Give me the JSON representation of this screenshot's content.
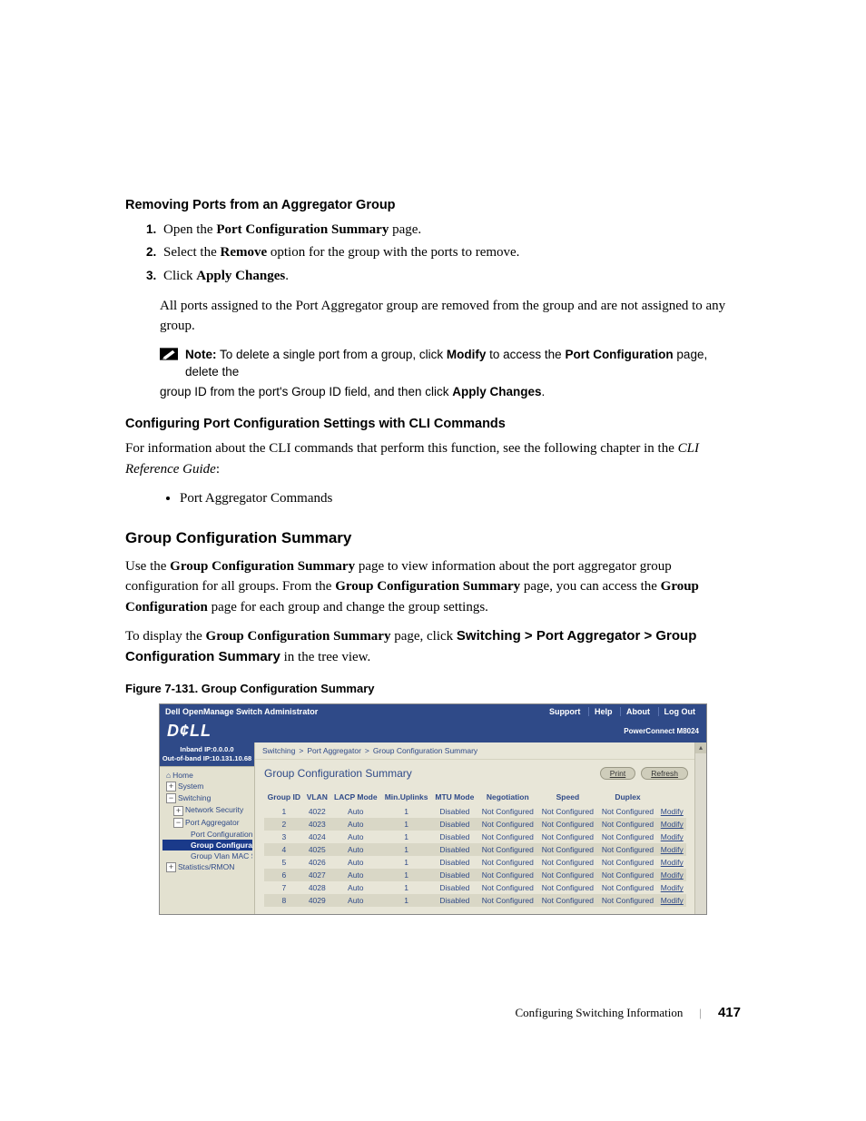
{
  "sec_removing": "Removing Ports from an Aggregator Group",
  "steps": [
    {
      "prefix": "Open the ",
      "b": "Port Configuration Summary",
      "suffix": " page."
    },
    {
      "prefix": "Select the ",
      "b": "Remove",
      "suffix": " option for the group with the ports to remove."
    },
    {
      "prefix": "Click ",
      "b": "Apply Changes",
      "suffix": "."
    }
  ],
  "step_body": "All ports assigned to the Port Aggregator group are removed from the group and are not assigned to any group.",
  "note": {
    "label": "Note:",
    "t1": " To delete a single port from a group, click ",
    "b1": "Modify",
    "t2": " to access the ",
    "b2": "Port Configuration",
    "t3": " page, delete the ",
    "cont1": "group ID from the port's Group ID field, and then click ",
    "b3": "Apply Changes",
    "cont2": "."
  },
  "sec_cli": "Configuring Port Configuration Settings with CLI Commands",
  "cli_para_pre": "For information about the CLI commands that perform this function, see the following chapter in the ",
  "cli_para_i": "CLI Reference Guide",
  "cli_para_post": ":",
  "bullet": "Port Aggregator Commands",
  "sec_gcs": "Group Configuration Summary",
  "gcs_p1_a": "Use the ",
  "gcs_p1_b": "Group Configuration Summary",
  "gcs_p1_c": " page to view information about the port aggregator group configuration for all groups. From the ",
  "gcs_p1_d": "Group Configuration Summary",
  "gcs_p1_e": " page, you can access the ",
  "gcs_p1_f": "Group Configuration",
  "gcs_p1_g": " page for each group and change the group settings.",
  "gcs_p2_a": "To display the ",
  "gcs_p2_b": "Group Configuration Summary",
  "gcs_p2_c": " page, click ",
  "gcs_p2_d": "Switching > Port Aggregator > Group Configuration Summary",
  "gcs_p2_e": " in the tree view.",
  "figcap": "Figure 7-131.    Group Configuration Summary",
  "shot": {
    "title": "Dell OpenManage Switch Administrator",
    "nav": [
      "Support",
      "Help",
      "About",
      "Log Out"
    ],
    "logo": "D¢LL",
    "model": "PowerConnect M8024",
    "ip1": "Inband IP:0.0.0.0",
    "ip2": "Out-of-band IP:10.131.10.68",
    "tree": [
      {
        "e": "",
        "lbl": "Home",
        "ind": 0,
        "sel": false,
        "icon": "home"
      },
      {
        "e": "+",
        "lbl": "System",
        "ind": 0
      },
      {
        "e": "−",
        "lbl": "Switching",
        "ind": 0
      },
      {
        "e": "+",
        "lbl": "Network Security",
        "ind": 1
      },
      {
        "e": "−",
        "lbl": "Port Aggregator",
        "ind": 1
      },
      {
        "e": "",
        "lbl": "Port Configuration S",
        "ind": 2
      },
      {
        "e": "",
        "lbl": "Group Configurati",
        "ind": 2,
        "sel": true
      },
      {
        "e": "",
        "lbl": "Group Vlan MAC Su",
        "ind": 2
      },
      {
        "e": "+",
        "lbl": "Statistics/RMON",
        "ind": 0
      }
    ],
    "crumb": [
      "Switching",
      "Port Aggregator",
      "Group Configuration Summary"
    ],
    "pagetitle": "Group Configuration Summary",
    "buttons": {
      "print": "Print",
      "refresh": "Refresh"
    },
    "columns": [
      "Group ID",
      "VLAN",
      "LACP Mode",
      "Min.Uplinks",
      "MTU Mode",
      "Negotiation",
      "Speed",
      "Duplex",
      ""
    ],
    "rows": [
      {
        "id": "1",
        "vlan": "4022",
        "lacp": "Auto",
        "min": "1",
        "mtu": "Disabled",
        "neg": "Not Configured",
        "spd": "Not Configured",
        "dup": "Not Configured",
        "act": "Modify"
      },
      {
        "id": "2",
        "vlan": "4023",
        "lacp": "Auto",
        "min": "1",
        "mtu": "Disabled",
        "neg": "Not Configured",
        "spd": "Not Configured",
        "dup": "Not Configured",
        "act": "Modify"
      },
      {
        "id": "3",
        "vlan": "4024",
        "lacp": "Auto",
        "min": "1",
        "mtu": "Disabled",
        "neg": "Not Configured",
        "spd": "Not Configured",
        "dup": "Not Configured",
        "act": "Modify"
      },
      {
        "id": "4",
        "vlan": "4025",
        "lacp": "Auto",
        "min": "1",
        "mtu": "Disabled",
        "neg": "Not Configured",
        "spd": "Not Configured",
        "dup": "Not Configured",
        "act": "Modify"
      },
      {
        "id": "5",
        "vlan": "4026",
        "lacp": "Auto",
        "min": "1",
        "mtu": "Disabled",
        "neg": "Not Configured",
        "spd": "Not Configured",
        "dup": "Not Configured",
        "act": "Modify"
      },
      {
        "id": "6",
        "vlan": "4027",
        "lacp": "Auto",
        "min": "1",
        "mtu": "Disabled",
        "neg": "Not Configured",
        "spd": "Not Configured",
        "dup": "Not Configured",
        "act": "Modify"
      },
      {
        "id": "7",
        "vlan": "4028",
        "lacp": "Auto",
        "min": "1",
        "mtu": "Disabled",
        "neg": "Not Configured",
        "spd": "Not Configured",
        "dup": "Not Configured",
        "act": "Modify"
      },
      {
        "id": "8",
        "vlan": "4029",
        "lacp": "Auto",
        "min": "1",
        "mtu": "Disabled",
        "neg": "Not Configured",
        "spd": "Not Configured",
        "dup": "Not Configured",
        "act": "Modify"
      }
    ]
  },
  "footer": {
    "chapter": "Configuring Switching Information",
    "page": "417"
  }
}
